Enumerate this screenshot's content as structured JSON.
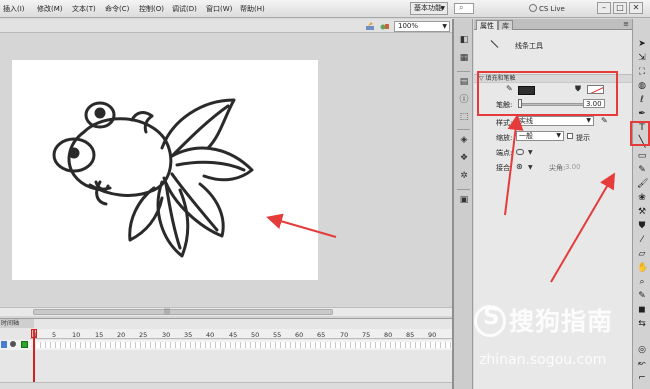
{
  "menu": {
    "items": [
      "插入(I)",
      "修改(M)",
      "文本(T)",
      "命令(C)",
      "控制(O)",
      "调试(D)",
      "窗口(W)",
      "帮助(H)"
    ],
    "workspace": "基本功能",
    "cs_live": "CS Live",
    "window_buttons": [
      "–",
      "□",
      "✕"
    ]
  },
  "stage": {
    "zoom": "100%"
  },
  "timeline": {
    "tab_label": "时间轴",
    "frame_numbers": [
      "1",
      "5",
      "10",
      "15",
      "20",
      "25",
      "30",
      "35",
      "40",
      "45",
      "50",
      "55",
      "60",
      "65",
      "70",
      "75",
      "80",
      "85",
      "90"
    ]
  },
  "panel": {
    "tabs": [
      "属性",
      "库"
    ],
    "tool_name": "线条工具",
    "section_title": "填充和笔触",
    "stroke_label": "笔触:",
    "stroke_value": "3.00",
    "style_label": "样式:",
    "style_value": "实线",
    "scale_label": "缩放:",
    "scale_value": "一般",
    "hint_label": "提示",
    "cap_label": "端点:",
    "join_label": "接合:",
    "miter_label": "尖角:",
    "miter_value": "3.00"
  },
  "colors": {
    "stroke_color": "#2f2f2f",
    "annotation_red": "#e53b3b"
  },
  "watermark": {
    "brand": "搜狗指南",
    "url": "zhinan.sogou.com"
  }
}
